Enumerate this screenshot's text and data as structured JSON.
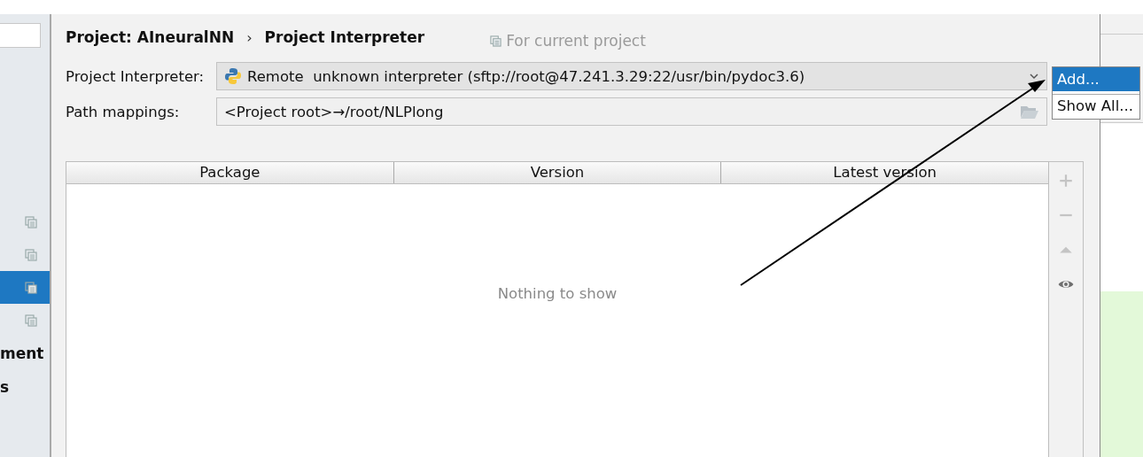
{
  "sidebar": {
    "items": [
      {
        "kind": "icon",
        "selected": false
      },
      {
        "kind": "icon",
        "selected": false
      },
      {
        "kind": "icon",
        "selected": true
      },
      {
        "kind": "icon",
        "selected": false
      },
      {
        "kind": "text",
        "label": "ment",
        "selected": false
      },
      {
        "kind": "text",
        "label": "s",
        "selected": false
      }
    ]
  },
  "breadcrumb": [
    "Project: AIneuralNN",
    "Project Interpreter"
  ],
  "breadcrumb_separator": "›",
  "scope_note": "For current project",
  "interpreter": {
    "label": "Project Interpreter:",
    "value": "Remote  unknown interpreter (sftp://root@47.241.3.29:22/usr/bin/pydoc3.6)"
  },
  "path_mappings": {
    "label": "Path mappings:",
    "value": "<Project root>→/root/NLPlong"
  },
  "popup_menu": [
    {
      "label": "Add...",
      "selected": true
    },
    {
      "label": "Show All...",
      "selected": false
    }
  ],
  "table": {
    "columns": [
      "Package",
      "Version",
      "Latest version"
    ],
    "empty_text": "Nothing to show"
  },
  "toolbar": [
    {
      "kind": "add",
      "disabled": true
    },
    {
      "kind": "remove",
      "disabled": true
    },
    {
      "kind": "upgrade",
      "disabled": true
    },
    {
      "kind": "eye",
      "disabled": false
    }
  ]
}
